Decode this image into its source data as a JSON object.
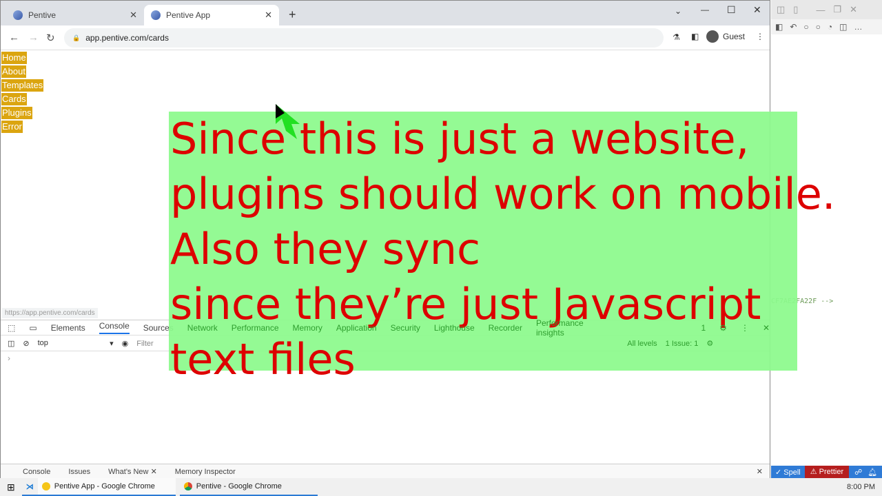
{
  "browser": {
    "tabs": [
      {
        "title": "Pentive",
        "active": false
      },
      {
        "title": "Pentive App",
        "active": true
      }
    ],
    "url": "app.pentive.com/cards",
    "profile": "Guest"
  },
  "page": {
    "nav": [
      "Home",
      "About",
      "Templates",
      "Cards",
      "Plugins",
      "Error"
    ],
    "status_url": "https://app.pentive.com/cards",
    "nav_color": "#dba510"
  },
  "overlay": {
    "lines": [
      "Since this is just a website,",
      "plugins should work on mobile.",
      "Also they sync",
      "since they’re just Javascript",
      "text files"
    ],
    "text_color": "#dd0000",
    "bg_color": "#98fb98"
  },
  "devtools": {
    "tabs": [
      "Elements",
      "Console",
      "Sources",
      "Network",
      "Performance",
      "Memory",
      "Application",
      "Security",
      "Lighthouse",
      "Recorder",
      "Performance insights"
    ],
    "active_tab": "Console",
    "context": "top",
    "filter_placeholder": "Filter",
    "levels": "All levels",
    "issues": "1 Issue: 1",
    "message_count": "1",
    "drawer_tabs": [
      "Console",
      "Issues",
      "What's New",
      "Memory Inspector"
    ]
  },
  "vscode": {
    "comment": "CF7AE2FA22F -->",
    "status": {
      "spell": "✓ Spell",
      "prettier": "⚠ Prettier"
    }
  },
  "taskbar": {
    "items": [
      "Pentive App - Google Chrome",
      "Pentive - Google Chrome"
    ],
    "time": "8:00 PM"
  }
}
